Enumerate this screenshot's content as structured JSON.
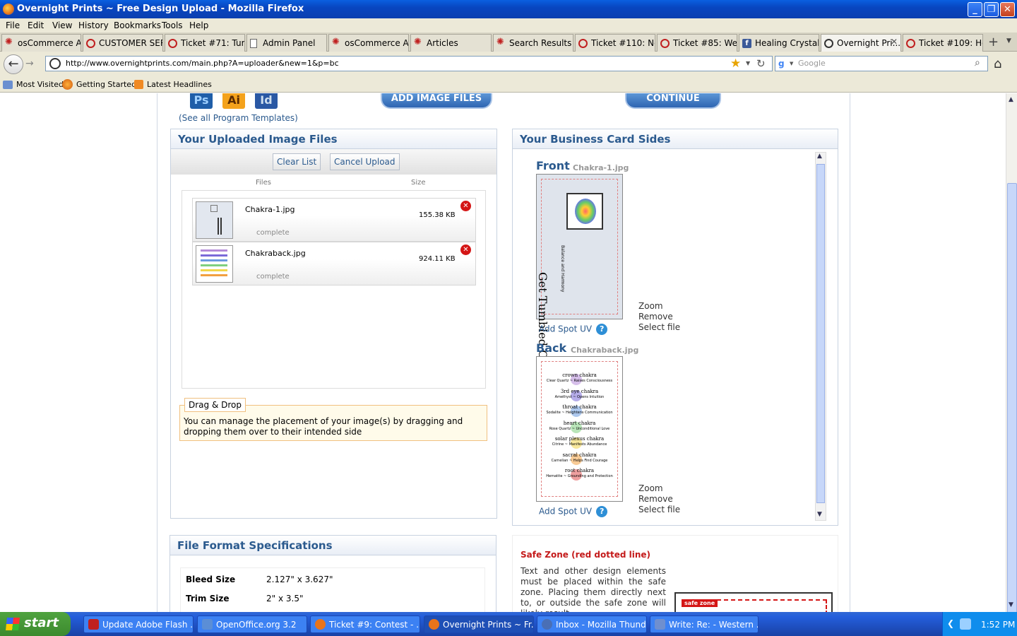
{
  "window": {
    "title": "Overnight Prints ~ Free Design Upload - Mozilla Firefox"
  },
  "menu": [
    "File",
    "Edit",
    "View",
    "History",
    "Bookmarks",
    "Tools",
    "Help"
  ],
  "tabs": [
    {
      "label": "osCommerce Ad...",
      "icon": "star-icon"
    },
    {
      "label": "CUSTOMER SER...",
      "icon": "oc-icon"
    },
    {
      "label": "Ticket #71: Tum...",
      "icon": "oc-icon"
    },
    {
      "label": "Admin Panel",
      "icon": "doc-icon"
    },
    {
      "label": "osCommerce Ad...",
      "icon": "star-icon"
    },
    {
      "label": "Articles",
      "icon": "star-icon"
    },
    {
      "label": "Search Results -...",
      "icon": "star-icon"
    },
    {
      "label": "Ticket #110: Ne...",
      "icon": "oc-icon"
    },
    {
      "label": "Ticket #85: Wea...",
      "icon": "oc-icon"
    },
    {
      "label": "Healing Crystals",
      "icon": "facebook-icon"
    },
    {
      "label": "Overnight Pri...",
      "icon": "overnightprints-icon"
    },
    {
      "label": "Ticket #109: Hol...",
      "icon": "oc-icon"
    }
  ],
  "url": "http://www.overnightprints.com/main.php?A=uploader&new=1&p=bc",
  "search_placeholder": "Google",
  "bookmarks": [
    "Most Visited",
    "Getting Started",
    "Latest Headlines"
  ],
  "top": {
    "ps": "Ps",
    "ai": "Ai",
    "id": "Id",
    "templates_link": "(See all Program Templates)",
    "add_files": "ADD IMAGE FILES",
    "continue": "CONTINUE"
  },
  "uploaded": {
    "heading": "Your Uploaded Image Files",
    "clear": "Clear List",
    "cancel": "Cancel Upload",
    "col_files": "Files",
    "col_size": "Size",
    "files": [
      {
        "name": "Chakra-1.jpg",
        "size": "155.38 KB",
        "status": "complete"
      },
      {
        "name": "Chakraback.jpg",
        "size": "924.11 KB",
        "status": "complete"
      }
    ],
    "drag_title": "Drag & Drop",
    "drag_text": "You can manage the placement of your image(s) by dragging and dropping them over to their intended side"
  },
  "sides": {
    "heading": "Your Business Card Sides",
    "front_label": "Front",
    "front_file": "Chakra-1.jpg",
    "back_label": "Back",
    "back_file": "Chakraback.jpg",
    "zoom": "Zoom",
    "remove": "Remove",
    "select": "Select file",
    "spot_uv": "Add Spot UV",
    "front_card_title": "Get Tumbled Chakra Set",
    "front_card_tag": "Balance and Harmony",
    "back_lines": [
      {
        "name": "crown chakra",
        "desc": "Clear Quartz ~ Raises Consciousness",
        "color": "#b48ad8"
      },
      {
        "name": "3rd eye chakra",
        "desc": "Amethyst ~ Opens Intuition",
        "color": "#7a6ad8"
      },
      {
        "name": "throat chakra",
        "desc": "Sodalite ~ Heightens Communication",
        "color": "#6a9ae0"
      },
      {
        "name": "heart chakra",
        "desc": "Rose Quartz ~ Unconditional Love",
        "color": "#7fcf7f"
      },
      {
        "name": "solar plexus chakra",
        "desc": "Citrine ~ Manifests Abundance",
        "color": "#f2d64a"
      },
      {
        "name": "sacral chakra",
        "desc": "Carnelian ~ Helps Find Courage",
        "color": "#f2a040"
      },
      {
        "name": "root chakra",
        "desc": "Hematite ~ Grounding and Protection",
        "color": "#e05050"
      }
    ]
  },
  "specs": {
    "heading": "File Format Specifications",
    "rows": [
      {
        "label": "Bleed Size",
        "value": "2.127\" x 3.627\""
      },
      {
        "label": "Trim Size",
        "value": "2\" x 3.5\""
      }
    ]
  },
  "safe": {
    "title": "Safe Zone (red dotted line)",
    "text": "Text and other design elements must be placed within the safe zone. Placing them directly next to, or outside the safe zone will likely result",
    "badge": "safe zone"
  },
  "taskbar": {
    "start": "start",
    "items": [
      {
        "label": "Update Adobe Flash ...",
        "color": "#c02020"
      },
      {
        "label": "OpenOffice.org 3.2",
        "color": "#5b8ed6"
      },
      {
        "label": "Ticket #9: Contest - ...",
        "color": "#e8741a"
      },
      {
        "label": "Overnight Prints ~ Fr...",
        "color": "#e8741a"
      },
      {
        "label": "Inbox - Mozilla Thund...",
        "color": "#4a6fb5"
      },
      {
        "label": "Write: Re: - Western ...",
        "color": "#6f8fcf"
      }
    ],
    "clock": "1:52 PM"
  }
}
